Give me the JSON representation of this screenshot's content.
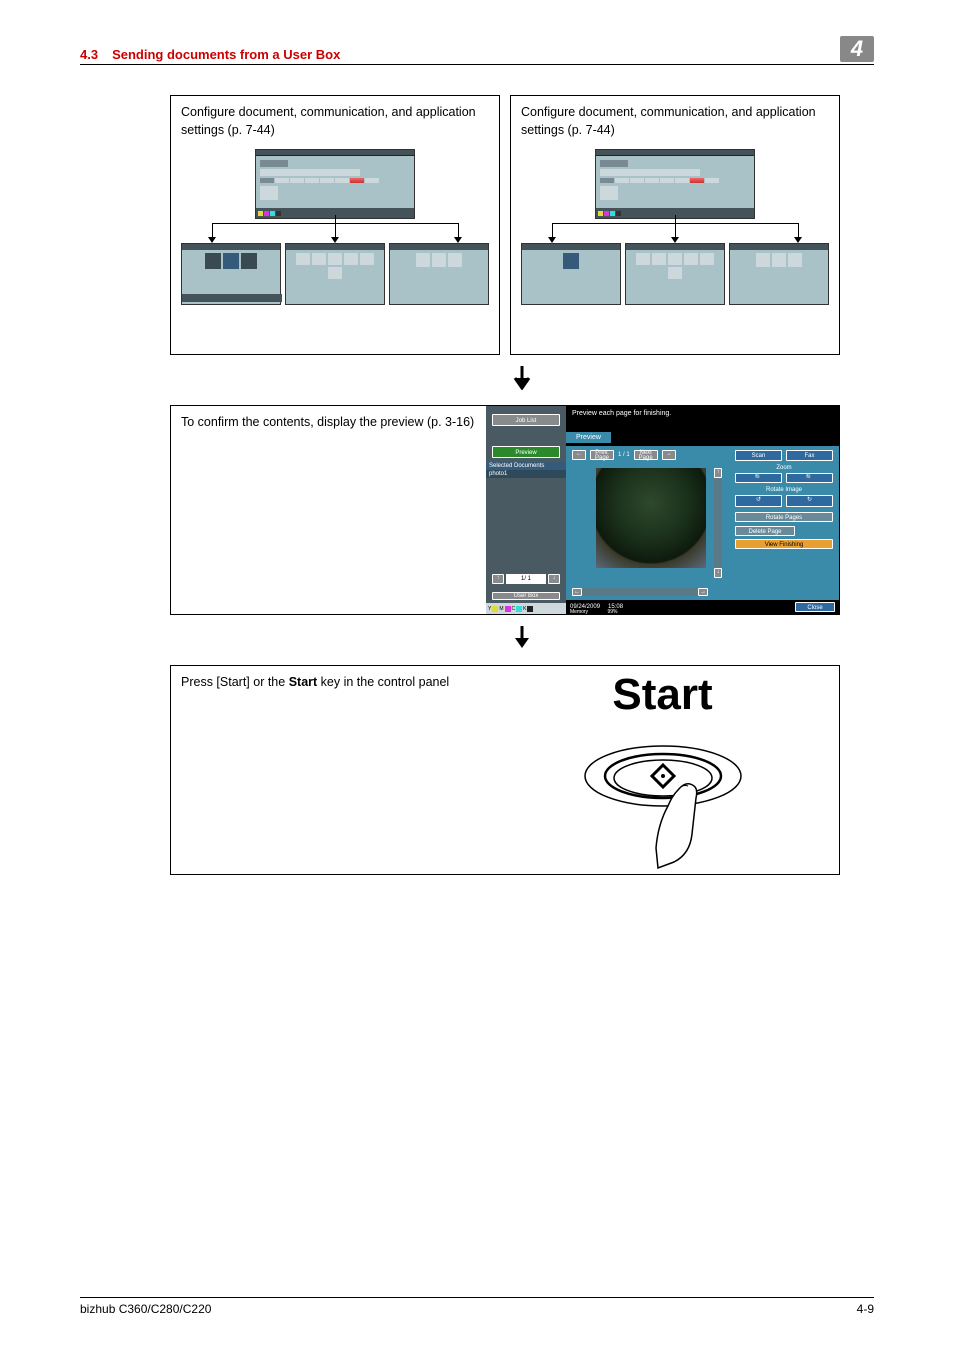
{
  "header": {
    "section_number": "4.3",
    "section_title": "Sending documents from a User Box",
    "chapter": "4"
  },
  "box1": {
    "text": "Configure document, communication, and application settings (p. 7-44)"
  },
  "box2": {
    "text": "Configure document, communication, and application settings (p. 7-44)"
  },
  "preview_box": {
    "text": "To confirm the contents, display the preview (p. 3-16)"
  },
  "preview_panel": {
    "job_list": "Job List",
    "hint": "Preview each page for finishing.",
    "preview_tab": "Preview",
    "preview_btn": "Preview",
    "selected_docs": "Selected Documents",
    "doc_name": "photo1",
    "prev_page": "Prev. Page",
    "next_page": "Next Page",
    "page_of": "1 / 1",
    "scan": "Scan",
    "fax": "Fax",
    "zoom": "Zoom",
    "rotate_image": "Rotate Image",
    "rotate_pages": "Rotate Pages",
    "view_finishing": "View Finishing",
    "delete_page": "Delete Page",
    "close": "Close",
    "date": "09/24/2009",
    "time": "15:08",
    "memory": "Memory",
    "mem_pct": "99%",
    "toner": {
      "y": "Y",
      "m": "M",
      "c": "C",
      "k": "K"
    },
    "nav_pager": "1/ 1"
  },
  "start_box": {
    "text_before": "Press [Start] or the ",
    "text_bold": "Start",
    "text_after": " key in the control panel",
    "start_label": "Start"
  },
  "footer": {
    "product": "bizhub C360/C280/C220",
    "page": "4-9"
  }
}
